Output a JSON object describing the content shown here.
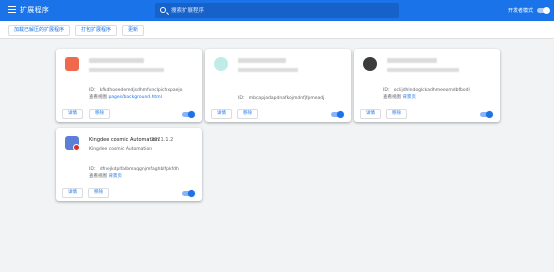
{
  "header": {
    "title": "扩展程序",
    "search_placeholder": "搜索扩展程序",
    "dev_mode_label": "开发者模式"
  },
  "toolbar": {
    "load_unpacked": "加载已解压的扩展程序",
    "pack": "打包扩展程序",
    "update": "更新"
  },
  "extensions": [
    {
      "name": "",
      "version": "",
      "description": "",
      "id": "ID： kfkdhoeedemdjsdhmfvnclpichxpaejo",
      "views_label": "查看视图",
      "views_link": "pages/background.html",
      "details": "详情",
      "remove": "移除",
      "enabled": true,
      "icon_color": "#ef6a4c"
    },
    {
      "name": "",
      "version": "",
      "description": "",
      "id": "ID： mbcapjadapdnafkojmdnfjfpmeadj",
      "views_label": "",
      "views_link": "",
      "details": "详情",
      "remove": "移除",
      "enabled": true,
      "icon_color": "#bfece6"
    },
    {
      "name": "",
      "version": "",
      "description": "",
      "id": "ID： oclijdhlndoglckadhmeeomdbfbodl",
      "views_label": "查看视图",
      "views_link": "背景页",
      "details": "详情",
      "remove": "移除",
      "enabled": true,
      "icon_color": "#3c3c3c"
    },
    {
      "name": "Kingdee cosmic Automation",
      "version": "2021.1.2",
      "description": "Kingdee cosmic Automation",
      "id": "ID： dfnejkdplfalbmaqgnjmfaghblfpkfdh",
      "views_label": "查看视图",
      "views_link": "背景页",
      "details": "详情",
      "remove": "移除",
      "enabled": true,
      "icon_color": "#5b7fd6"
    }
  ]
}
